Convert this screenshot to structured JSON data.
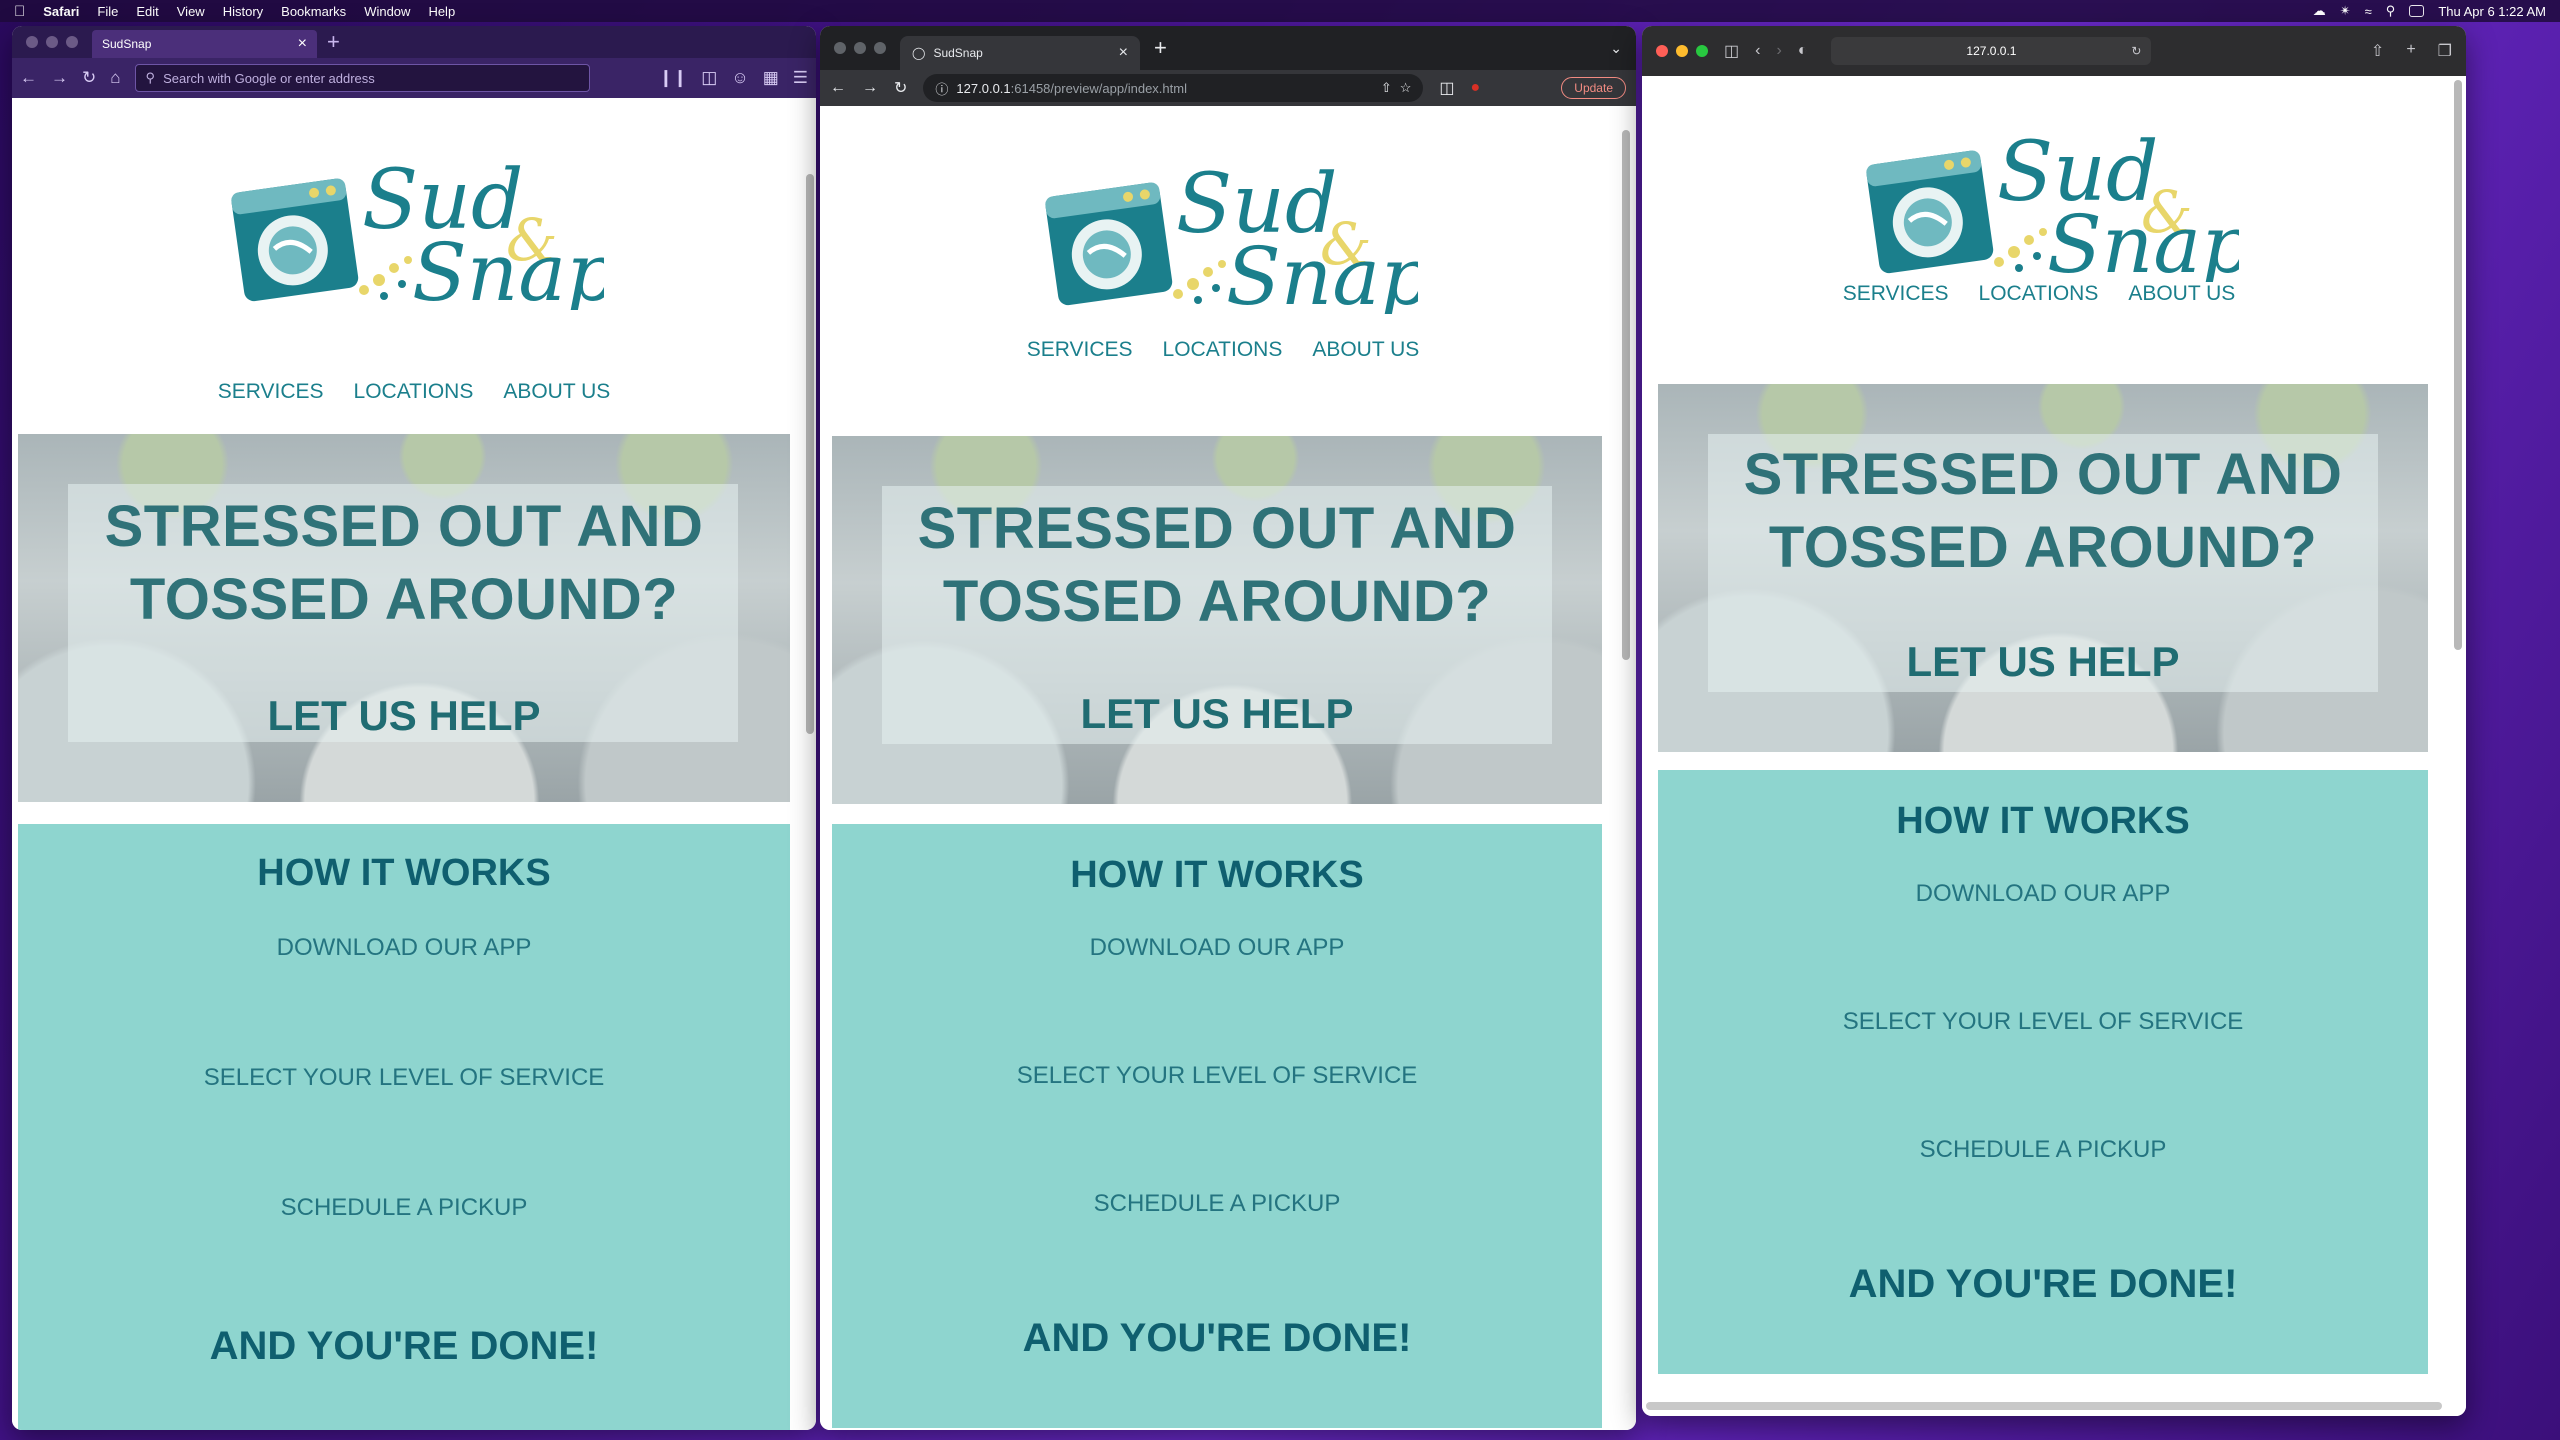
{
  "menubar": {
    "app": "Safari",
    "items": [
      "File",
      "Edit",
      "View",
      "History",
      "Bookmarks",
      "Window",
      "Help"
    ],
    "clock": "Thu Apr 6  1:22 AM"
  },
  "firefox": {
    "tab_title": "SudSnap",
    "url_placeholder": "Search with Google or enter address"
  },
  "chrome": {
    "tab_title": "SudSnap",
    "url_host": "127.0.0.1",
    "url_rest": ":61458/preview/app/index.html",
    "update_label": "Update"
  },
  "safari": {
    "url": "127.0.0.1"
  },
  "site": {
    "logo_word1": "Sud",
    "logo_amp": "&",
    "logo_word2": "Snap",
    "nav": [
      "SERVICES",
      "LOCATIONS",
      "ABOUT US"
    ],
    "hero_line1": "STRESSED OUT AND",
    "hero_line2": "TOSSED AROUND?",
    "hero_cta": "LET US HELP",
    "how_title": "HOW IT WORKS",
    "steps": [
      "DOWNLOAD OUR APP",
      "SELECT YOUR LEVEL OF SERVICE",
      "SCHEDULE A PICKUP"
    ],
    "done": "AND YOU'RE DONE!"
  },
  "colors": {
    "brand_teal": "#1b7f8c",
    "how_bg": "#8ed5cf",
    "logo_yellow": "#e8d66a"
  }
}
